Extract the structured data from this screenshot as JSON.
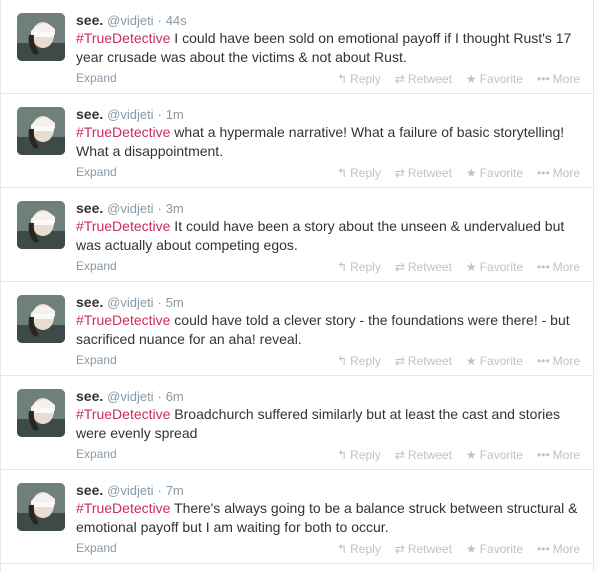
{
  "tweets": [
    {
      "fullname": "see.",
      "username": "@vidjeti",
      "separator": "·",
      "time": "44s",
      "hashtag": "#TrueDetective",
      "text": " I could have been sold on emotional payoff if I thought Rust's 17 year crusade was about the victims & not about Rust.",
      "expand": "Expand"
    },
    {
      "fullname": "see.",
      "username": "@vidjeti",
      "separator": "·",
      "time": "1m",
      "hashtag": "#TrueDetective",
      "text": " what a hypermale narrative! What a failure of basic storytelling! What a disappointment.",
      "expand": "Expand"
    },
    {
      "fullname": "see.",
      "username": "@vidjeti",
      "separator": "·",
      "time": "3m",
      "hashtag": "#TrueDetective",
      "text": " It could have been a story about the unseen & undervalued but was actually about competing egos.",
      "expand": "Expand"
    },
    {
      "fullname": "see.",
      "username": "@vidjeti",
      "separator": "·",
      "time": "5m",
      "hashtag": "#TrueDetective",
      "text": " could have told a clever story - the foundations were there! - but sacrificed nuance for an aha! reveal.",
      "expand": "Expand"
    },
    {
      "fullname": "see.",
      "username": "@vidjeti",
      "separator": "·",
      "time": "6m",
      "hashtag": "#TrueDetective",
      "text": " Broadchurch suffered similarly but at least the cast and stories were evenly spread",
      "expand": "Expand"
    },
    {
      "fullname": "see.",
      "username": "@vidjeti",
      "separator": "·",
      "time": "7m",
      "hashtag": "#TrueDetective",
      "text": " There's always going to be a balance struck between structural & emotional payoff but I am waiting for both to occur.",
      "expand": "Expand"
    }
  ],
  "actions": {
    "reply": "Reply",
    "retweet": "Retweet",
    "favorite": "Favorite",
    "more": "More"
  },
  "icons": {
    "reply": "reply-icon",
    "retweet": "retweet-icon",
    "favorite": "star-icon",
    "more": "more-dots-icon"
  },
  "colors": {
    "hashtag": "#cc2d59",
    "muted": "#8899a6",
    "action": "#b8c4cc"
  }
}
